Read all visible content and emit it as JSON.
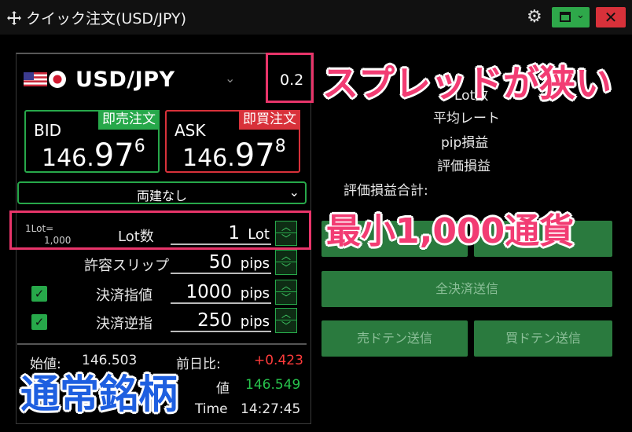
{
  "window": {
    "title": "クイック注文(USD/JPY)",
    "close_symbol": "✕",
    "icons": [
      "move-icon",
      "gear-icon",
      "window-layout-icon",
      "close-icon"
    ]
  },
  "symbol": {
    "pair": "USD/JPY",
    "spread": "0.2",
    "flags": [
      "us-flag",
      "jp-flag"
    ]
  },
  "bid": {
    "label": "BID",
    "tag": "即売注文",
    "price_main": "146.",
    "price_big": "97",
    "price_pip": "6"
  },
  "ask": {
    "label": "ASK",
    "tag": "即買注文",
    "price_main": "146.",
    "price_big": "97",
    "price_pip": "8"
  },
  "hedge": {
    "selected": "両建なし"
  },
  "order_form": {
    "lot_note_1": "1Lot=",
    "lot_note_2": "1,000",
    "lot_label": "Lot数",
    "lot_value": "1",
    "lot_unit": "Lot",
    "slip_label": "許容スリップ",
    "slip_value": "50",
    "slip_unit": "pips",
    "limit_label": "決済指値",
    "limit_value": "1000",
    "limit_unit": "pips",
    "limit_checked": true,
    "stop_label": "決済逆指",
    "stop_value": "250",
    "stop_unit": "pips",
    "stop_checked": true
  },
  "stats": {
    "open_label": "始値:",
    "open_value": "146.503",
    "change_label": "前日比:",
    "change_value": "+0.423",
    "high_label": "値",
    "high_value": "146.549",
    "time_label": "Time",
    "time_value": "14:27:45"
  },
  "positions": {
    "lots_label": "Lot数",
    "avg_rate_label": "平均レート",
    "pip_pl_label": "pip損益",
    "pl_label": "評価損益",
    "total_pl_label": "評価損益合計:"
  },
  "buttons": {
    "close_all": "全決済送信",
    "sell_doten": "売ドテン送信",
    "buy_doten": "買ドテン送信"
  },
  "annotations": {
    "narrow_spread": "スプレッドが狭い",
    "min_units": "最小1,000通貨",
    "normal_symbol": "通常銘柄"
  },
  "colors": {
    "bid_green": "#27a84a",
    "ask_red": "#d8313a",
    "change_red": "#ff3b3b",
    "high_green": "#27c24c",
    "highlight_pink": "#e8356a"
  }
}
